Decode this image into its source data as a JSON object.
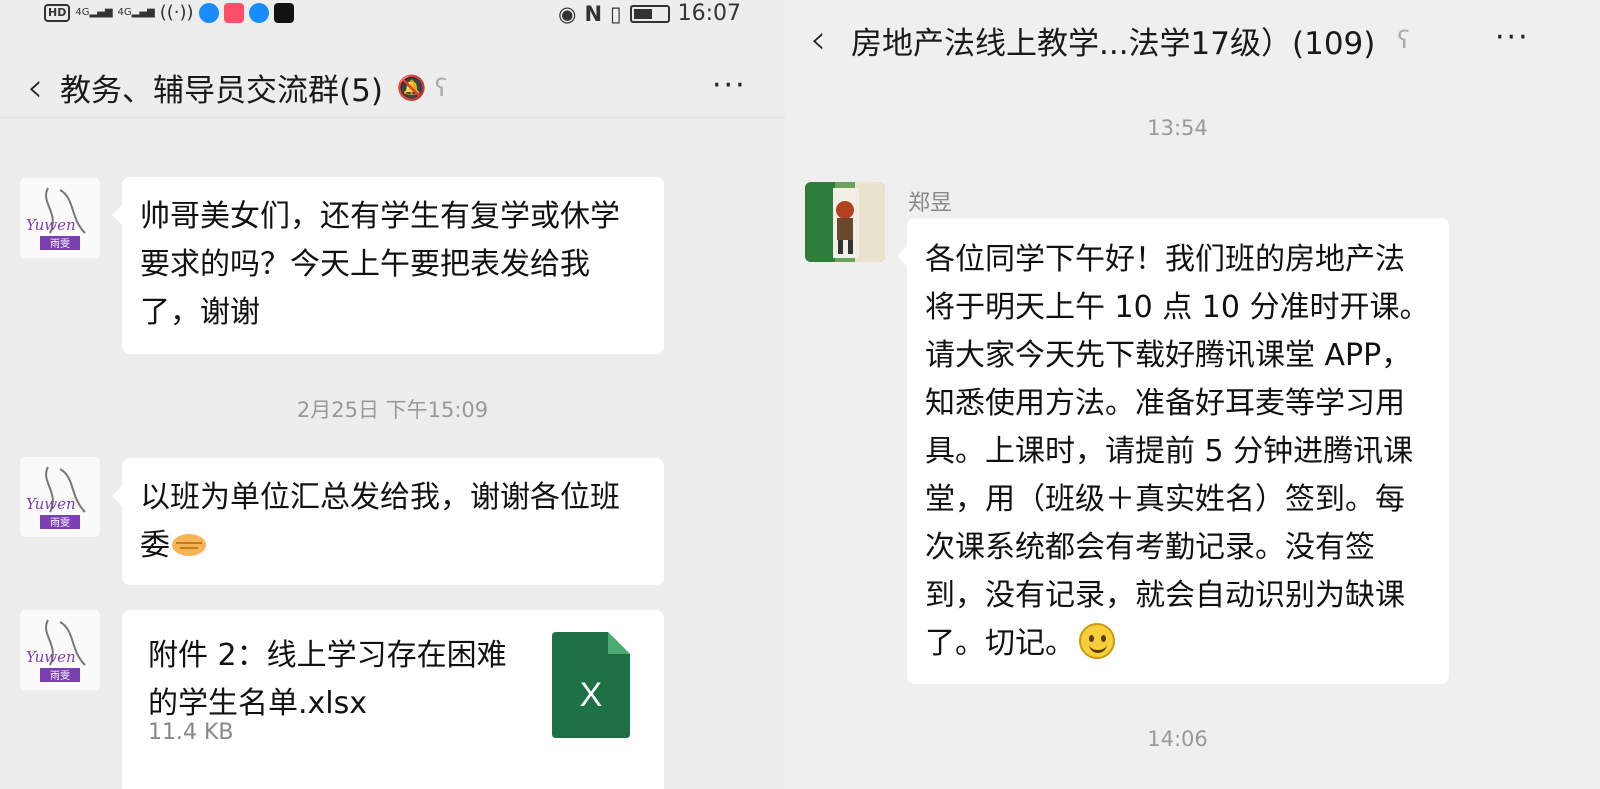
{
  "left": {
    "status": {
      "time": "16:07",
      "hd": "HD",
      "signal1": "4G",
      "signal2": "4G"
    },
    "header": {
      "title": "教务、辅导员交流群(5)",
      "more": "···"
    },
    "messages": [
      {
        "text": "帅哥美女们，还有学生有复学或休学要求的吗？今天上午要把表发给我了，谢谢"
      },
      {
        "timestamp": "2月25日 下午15:09"
      },
      {
        "text": "以班为单位汇总发给我，谢谢各位班委"
      },
      {
        "file": {
          "name": "附件 2：线上学习存在困难的学生名单.xlsx",
          "size": "11.4 KB",
          "icon_letter": "X"
        }
      }
    ],
    "avatar_caption": "雨雯"
  },
  "right": {
    "header": {
      "title": "房地产法线上教学...法学17级）(109)",
      "more": "···"
    },
    "timestamp1": "13:54",
    "sender": "郑昱",
    "message": "各位同学下午好！我们班的房地产法将于明天上午 10 点 10 分准时开课。请大家今天先下载好腾讯课堂 APP，知悉使用方法。准备好耳麦等学习用具。上课时，请提前 5 分钟进腾讯课堂，用（班级＋真实姓名）签到。每次课系统都会有考勤记录。没有签到，没有记录，就会自动识别为缺课了。切记。",
    "timestamp2": "14:06"
  },
  "colors": {
    "bg": "#ededed",
    "bubble": "#ffffff",
    "excel": "#1e7145",
    "muted": "#999999"
  }
}
